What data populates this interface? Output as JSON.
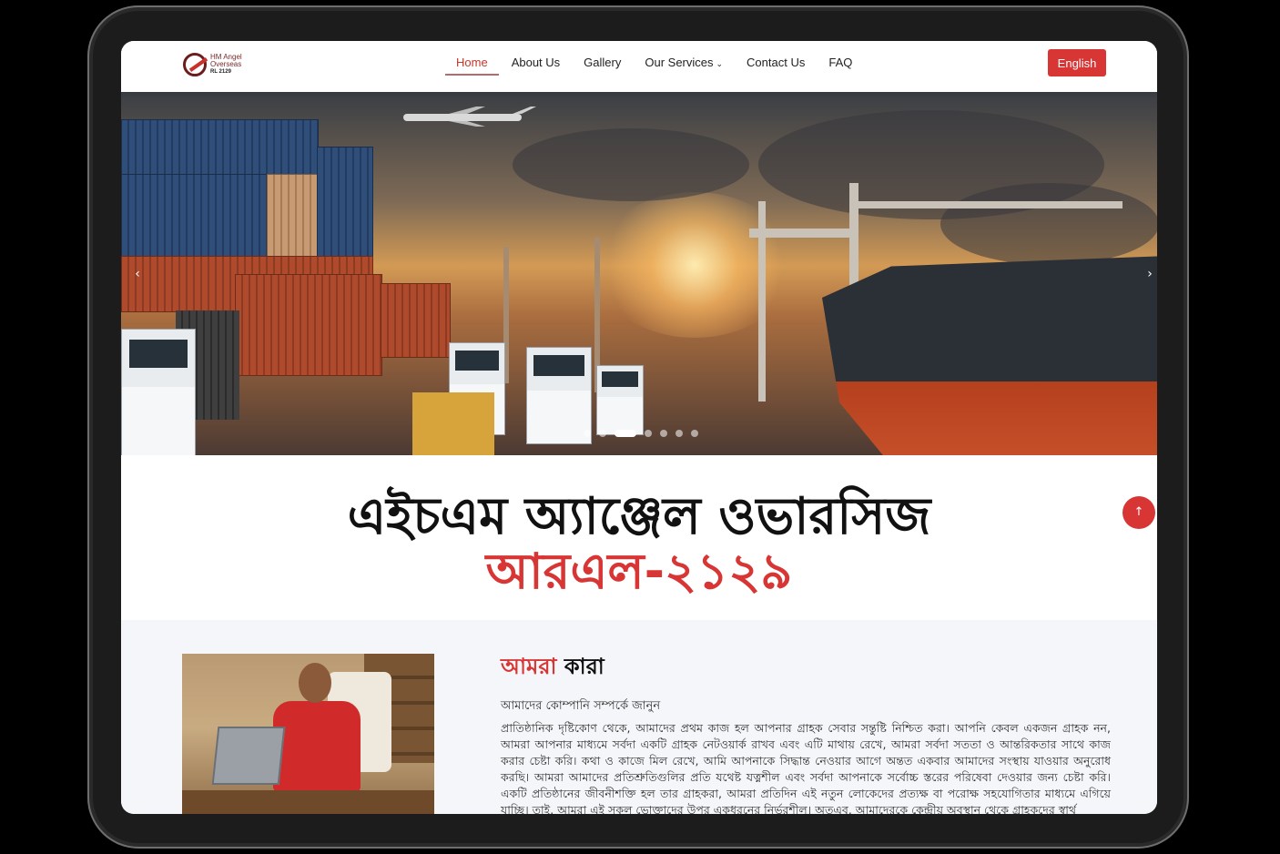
{
  "header": {
    "logo": {
      "line1": "HM Angel",
      "line2": "Overseas",
      "line3": "RL 2129"
    },
    "nav": [
      {
        "label": "Home",
        "active": true
      },
      {
        "label": "About Us"
      },
      {
        "label": "Gallery"
      },
      {
        "label": "Our Services",
        "has_dropdown": true
      },
      {
        "label": "Contact Us"
      },
      {
        "label": "FAQ"
      }
    ],
    "language_button": "English",
    "accent_color": "#d83535"
  },
  "hero": {
    "prev_arrow": "‹",
    "next_arrow": "›",
    "slide_count": 7,
    "active_slide": 3
  },
  "title": {
    "line1": "এইচএম অ্যাঞ্জেল ওভারসিজ",
    "line2": "আরএল-২১২৯"
  },
  "scroll_top_icon": "↑",
  "about": {
    "heading_red": "আমরা",
    "heading_black": "কারা",
    "subtitle": "আমাদের কোম্পানি সম্পর্কে জানুন",
    "paragraph": "প্রাতিষ্ঠানিক দৃষ্টিকোণ থেকে, আমাদের প্রথম কাজ হল আপনার গ্রাহক সেবার সন্তুষ্টি নিশ্চিত করা। আপনি কেবল একজন গ্রাহক নন, আমরা আপনার মাধ্যমে সর্বদা একটি গ্রাহক নেটওয়ার্ক রাখব এবং এটি মাথায় রেখে, আমরা সর্বদা সততা ও আন্তরিকতার সাথে কাজ করার চেষ্টা করি। কথা ও কাজে মিল রেখে, আমি আপনাকে সিদ্ধান্ত নেওয়ার আগে অন্তত একবার আমাদের সংস্থায় যাওয়ার অনুরোধ করছি। আমরা আমাদের প্রতিশ্রুতিগুলির প্রতি যথেষ্ট যত্নশীল এবং সর্বদা আপনাকে সর্বোচ্চ স্তরের পরিষেবা দেওয়ার জন্য চেষ্টা করি। একটি প্রতিষ্ঠানের জীবনীশক্তি হল তার গ্রাহকরা, আমরা প্রতিদিন এই নতুন লোকেদের প্রত্যক্ষ বা পরোক্ষ সহযোগিতার মাধ্যমে এগিয়ে যাচ্ছি। তাই, আমরা এই সকল ভোক্তাদের উপর একধরনের নির্ভরশীল। অতএব, আমাদেরকে কেন্দ্রীয় অবস্থান থেকে গ্রাহকদের স্বার্থ"
  }
}
